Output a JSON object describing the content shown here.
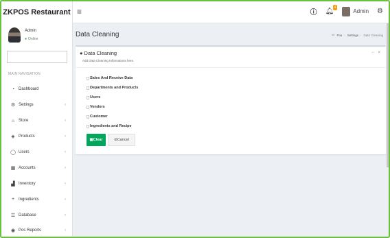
{
  "app": {
    "brand": "ZKPOS Restaurant"
  },
  "topbar": {
    "notification_count": "4",
    "user_label": "Admin",
    "icons": [
      "menu-icon",
      "info-icon",
      "bell-icon",
      "gear-icon"
    ]
  },
  "sidebar": {
    "user": {
      "name": "Admin",
      "status": "Online"
    },
    "nav_header": "MAIN NAVIGATION",
    "items": [
      {
        "label": "Dashboard",
        "icon": "dashboard-icon",
        "caret": ""
      },
      {
        "label": "Settings",
        "icon": "gear-icon",
        "caret": "‹"
      },
      {
        "label": "Store",
        "icon": "home-icon",
        "caret": "‹"
      },
      {
        "label": "Products",
        "icon": "tag-icon",
        "caret": "‹"
      },
      {
        "label": "Users",
        "icon": "user-icon",
        "caret": "‹"
      },
      {
        "label": "Accounts",
        "icon": "table-icon",
        "caret": "‹"
      },
      {
        "label": "Inventory",
        "icon": "chart-icon",
        "caret": "‹"
      },
      {
        "label": "Ingredients",
        "icon": "plus-icon",
        "caret": "‹"
      },
      {
        "label": "Database",
        "icon": "database-icon",
        "caret": "‹"
      },
      {
        "label": "Pos Reports",
        "icon": "eye-icon",
        "caret": "‹"
      }
    ]
  },
  "content": {
    "page_title": "Data Cleaning",
    "breadcrumb": {
      "home": "Pos",
      "parent": "Settings",
      "current": "Data Cleaning"
    },
    "box": {
      "title": "Data Cleaning",
      "subtitle": "Add Data Cleaning Informations here.",
      "options": [
        "Sales And Receive Data",
        "Departments and Products",
        "Users",
        "Vendors",
        "Customer",
        "Ingredients and Recipe"
      ],
      "clear_label": "Clear",
      "cancel_label": "Cancel"
    }
  }
}
